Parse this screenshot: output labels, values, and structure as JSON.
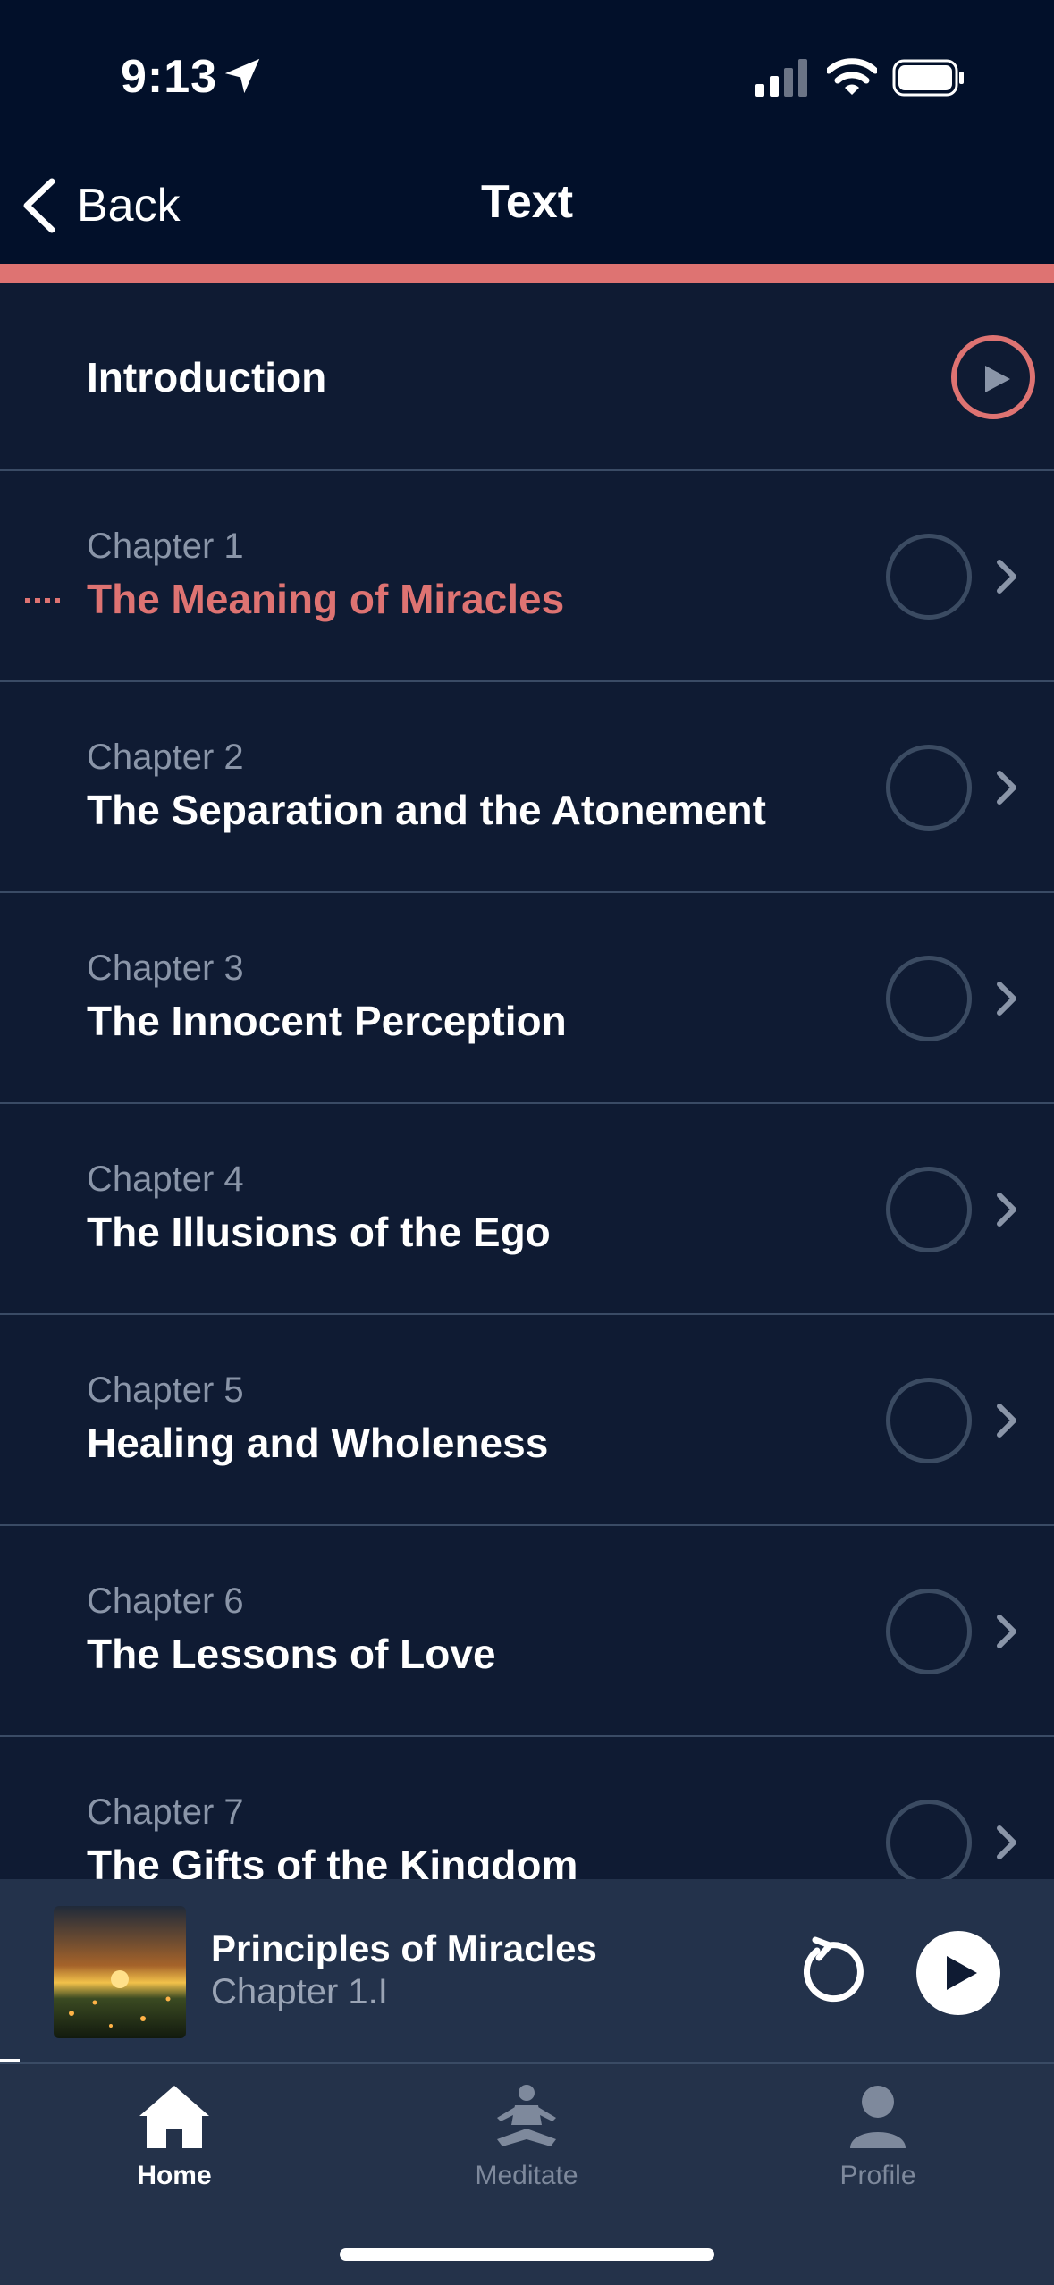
{
  "status_bar": {
    "time": "9:13"
  },
  "nav": {
    "back_label": "Back",
    "title": "Text"
  },
  "intro": {
    "label": "Introduction"
  },
  "chapters": [
    {
      "number": "Chapter 1",
      "title": "The Meaning of Miracles"
    },
    {
      "number": "Chapter 2",
      "title": "The Separation and the Atonement"
    },
    {
      "number": "Chapter 3",
      "title": "The Innocent Perception"
    },
    {
      "number": "Chapter 4",
      "title": "The Illusions of the Ego"
    },
    {
      "number": "Chapter 5",
      "title": "Healing and Wholeness"
    },
    {
      "number": "Chapter 6",
      "title": "The Lessons of Love"
    },
    {
      "number": "Chapter 7",
      "title": "The Gifts of the Kingdom"
    }
  ],
  "current_chapter_index": 0,
  "mini_player": {
    "title": "Principles of Miracles",
    "subtitle": "Chapter 1.I"
  },
  "tabs": [
    {
      "label": "Home",
      "icon": "home-icon",
      "active": true
    },
    {
      "label": "Meditate",
      "icon": "meditate-icon",
      "active": false
    },
    {
      "label": "Profile",
      "icon": "profile-icon",
      "active": false
    }
  ],
  "colors": {
    "accent": "#de7372",
    "background": "#0f1b33",
    "header": "#02102a",
    "tabbar": "#24324a"
  }
}
